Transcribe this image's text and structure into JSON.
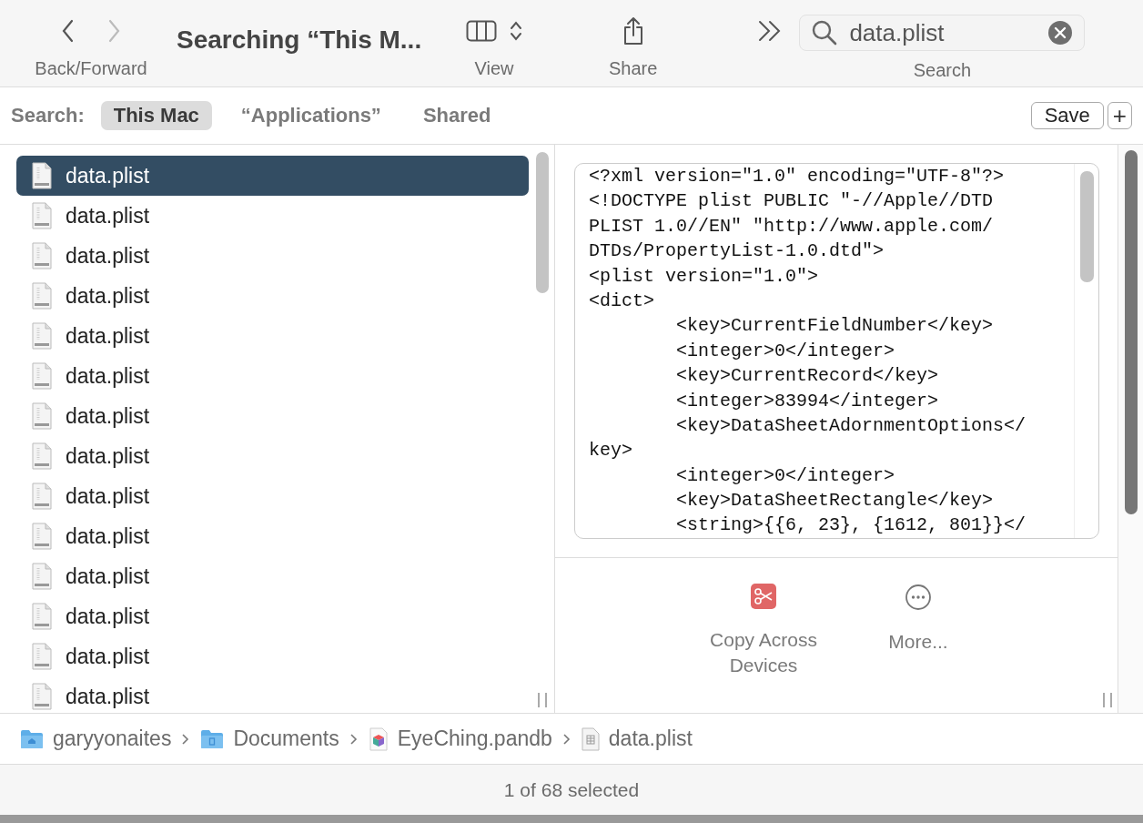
{
  "toolbar": {
    "nav_label": "Back/Forward",
    "title": "Searching “This M...",
    "view_label": "View",
    "share_label": "Share",
    "search": {
      "value": "data.plist",
      "label": "Search"
    }
  },
  "scope_bar": {
    "label": "Search:",
    "scopes": [
      {
        "label": "This Mac",
        "selected": true
      },
      {
        "label": "“Applications”",
        "selected": false
      },
      {
        "label": "Shared",
        "selected": false
      }
    ],
    "save": "Save",
    "add": "+"
  },
  "files": [
    {
      "name": "data.plist",
      "selected": true
    },
    {
      "name": "data.plist",
      "selected": false
    },
    {
      "name": "data.plist",
      "selected": false
    },
    {
      "name": "data.plist",
      "selected": false
    },
    {
      "name": "data.plist",
      "selected": false
    },
    {
      "name": "data.plist",
      "selected": false
    },
    {
      "name": "data.plist",
      "selected": false
    },
    {
      "name": "data.plist",
      "selected": false
    },
    {
      "name": "data.plist",
      "selected": false
    },
    {
      "name": "data.plist",
      "selected": false
    },
    {
      "name": "data.plist",
      "selected": false
    },
    {
      "name": "data.plist",
      "selected": false
    },
    {
      "name": "data.plist",
      "selected": false
    },
    {
      "name": "data.plist",
      "selected": false
    }
  ],
  "preview": {
    "lines": [
      "<?xml version=\"1.0\" encoding=\"UTF-8\"?>",
      "<!DOCTYPE plist PUBLIC \"-//Apple//DTD",
      "PLIST 1.0//EN\" \"http://www.apple.com/",
      "DTDs/PropertyList-1.0.dtd\">",
      "<plist version=\"1.0\">",
      "<dict>",
      "\t<key>CurrentFieldNumber</key>",
      "\t<integer>0</integer>",
      "\t<key>CurrentRecord</key>",
      "\t<integer>83994</integer>",
      "\t<key>DataSheetAdornmentOptions</",
      "key>",
      "\t<integer>0</integer>",
      "\t<key>DataSheetRectangle</key>",
      "\t<string>{{6, 23}, {1612, 801}}</"
    ],
    "actions": [
      {
        "kind": "scissors",
        "label": "Copy Across Devices"
      },
      {
        "kind": "more",
        "label": "More..."
      }
    ]
  },
  "path_bar": [
    {
      "kind": "home-folder",
      "label": "garyyonaites"
    },
    {
      "kind": "folder",
      "label": "Documents"
    },
    {
      "kind": "package",
      "label": "EyeChing.pandb"
    },
    {
      "kind": "plist",
      "label": "data.plist"
    }
  ],
  "status_bar": "1 of 68 selected"
}
